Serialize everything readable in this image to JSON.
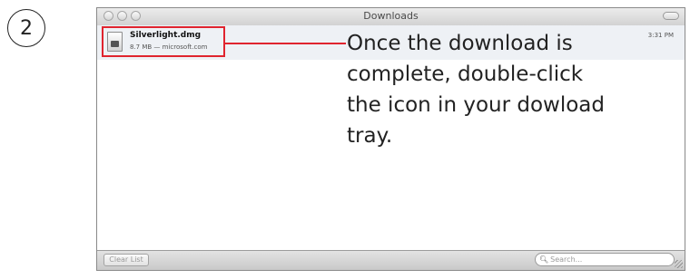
{
  "step": {
    "number": "2"
  },
  "window": {
    "title": "Downloads",
    "download": {
      "file_name": "Silverlight.dmg",
      "meta": "8.7 MB — microsoft.com",
      "time": "3:31 PM"
    },
    "clear_label": "Clear List",
    "search_placeholder": "Search..."
  },
  "callout": {
    "text": "Once the download is complete, double-click the icon in your dowload tray."
  },
  "colors": {
    "highlight": "#e0242e"
  }
}
